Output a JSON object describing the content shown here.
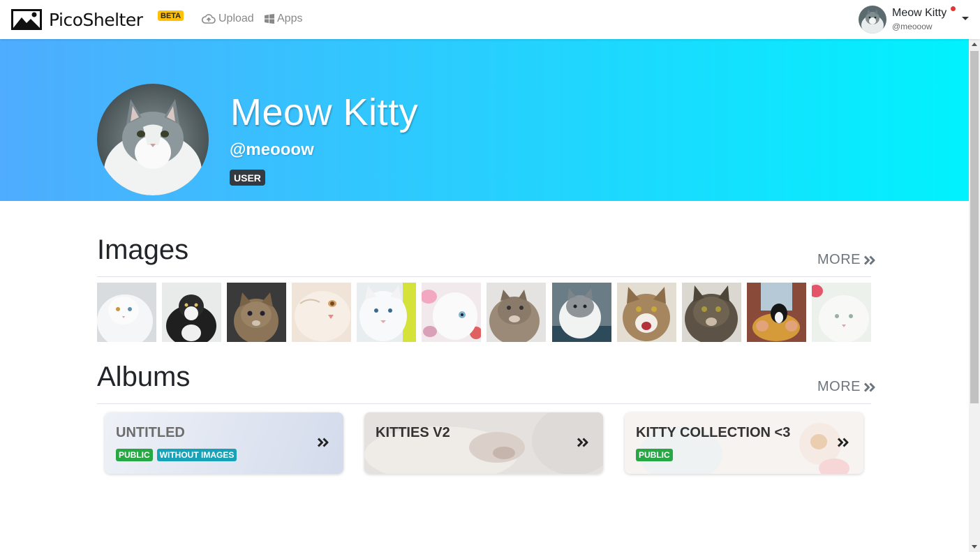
{
  "navbar": {
    "brand_name": "PicoShelter",
    "beta_label": "BETA",
    "upload_label": "Upload",
    "apps_label": "Apps",
    "user_name": "Meow Kitty",
    "user_handle": "@meooow"
  },
  "profile": {
    "name": "Meow Kitty",
    "handle": "@meooow",
    "role": "USER"
  },
  "images_section": {
    "title": "Images",
    "more_label": "MORE",
    "thumbnails": [
      "white-cat",
      "black-white-cat",
      "tabby-kitten",
      "cream-cat",
      "white-cat-yellow",
      "white-kitten-pink",
      "cat-looking-up",
      "grey-white-kitten",
      "tabby-meowing",
      "tabby-adult",
      "tuxedo-kitten-hands",
      "white-cat-pink"
    ]
  },
  "albums_section": {
    "title": "Albums",
    "more_label": "MORE",
    "albums": [
      {
        "title": "UNTITLED",
        "badges": [
          "PUBLIC",
          "WITHOUT IMAGES"
        ]
      },
      {
        "title": "KITTIES V2",
        "badges": []
      },
      {
        "title": "KITTY COLLECTION <3",
        "badges": [
          "PUBLIC"
        ]
      }
    ]
  },
  "colors": {
    "banner_start": "#4facfe",
    "banner_end": "#00f2fe",
    "badge_public": "#28a745",
    "badge_without_images": "#17a2b8",
    "beta_badge": "#ffc107",
    "role_badge": "#343a40"
  }
}
